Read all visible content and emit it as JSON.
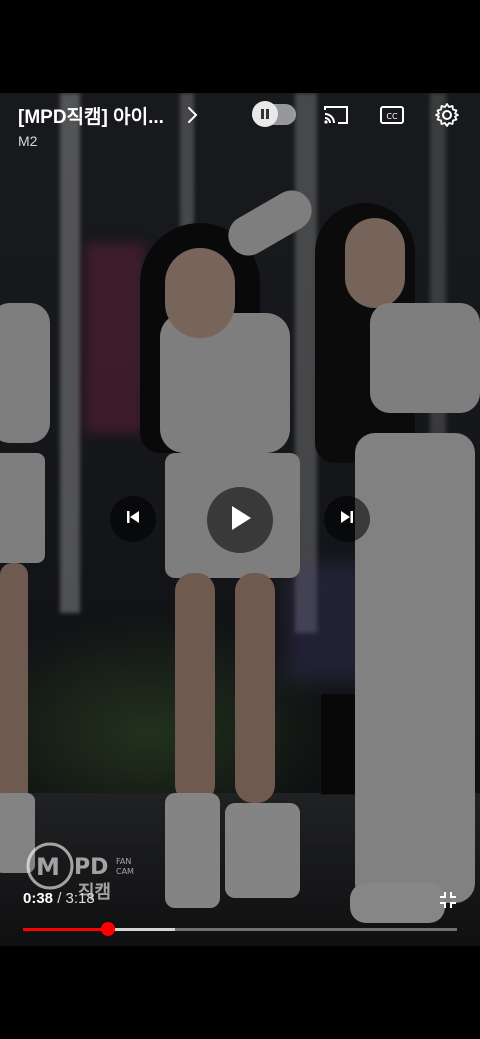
{
  "player": {
    "title": "[MPD직캠] 아이...",
    "channel": "M2",
    "time": {
      "current": "0:38",
      "separator": " / ",
      "duration": "3:18"
    },
    "progress": {
      "played_fraction": 0.195,
      "buffered_fraction": 0.35
    },
    "autoplay_toggle": {
      "state": "paused"
    },
    "watermark": {
      "brand": "M PD",
      "tag": "FAN CAM",
      "korean": "직캠"
    }
  },
  "icons": {
    "title_chevron": "chevron-right-icon",
    "autoplay": "pause-icon",
    "cast": "cast-icon",
    "captions": "closed-captions-icon",
    "settings": "gear-icon",
    "previous": "skip-previous-icon",
    "play": "play-icon",
    "next": "skip-next-icon",
    "fullscreen": "exit-fullscreen-icon"
  },
  "colors": {
    "progress_played": "#ff0000",
    "background": "#000000"
  }
}
